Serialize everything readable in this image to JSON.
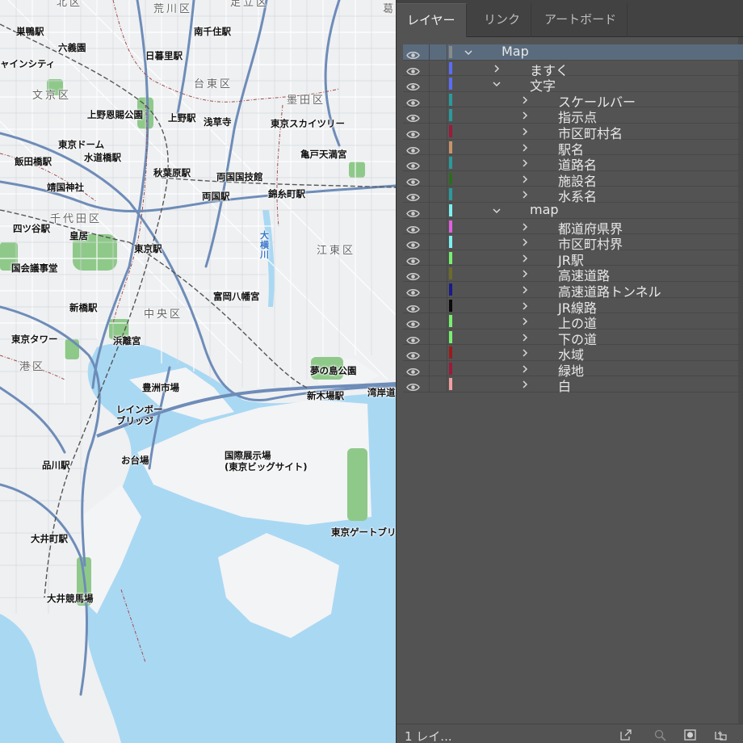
{
  "map": {
    "labels": [
      {
        "text": "北区",
        "cls": "ward"
      },
      {
        "text": "荒川区",
        "cls": "ward"
      },
      {
        "text": "足立区",
        "cls": "ward"
      },
      {
        "text": "葛",
        "cls": "ward"
      },
      {
        "text": "巣鴨駅",
        "cls": ""
      },
      {
        "text": "六義園",
        "cls": ""
      },
      {
        "text": "南千住駅",
        "cls": ""
      },
      {
        "text": "ャインシティ",
        "cls": ""
      },
      {
        "text": "日暮里駅",
        "cls": ""
      },
      {
        "text": "台東区",
        "cls": "ward"
      },
      {
        "text": "文京区",
        "cls": "ward"
      },
      {
        "text": "墨田区",
        "cls": "ward"
      },
      {
        "text": "上野恩賜公園",
        "cls": ""
      },
      {
        "text": "上野駅",
        "cls": ""
      },
      {
        "text": "浅草寺",
        "cls": ""
      },
      {
        "text": "東京スカイツリー",
        "cls": ""
      },
      {
        "text": "東京ドーム",
        "cls": ""
      },
      {
        "text": "水道橋駅",
        "cls": ""
      },
      {
        "text": "亀戸天満宮",
        "cls": ""
      },
      {
        "text": "飯田橋駅",
        "cls": ""
      },
      {
        "text": "秋葉原駅",
        "cls": ""
      },
      {
        "text": "両国国技館",
        "cls": ""
      },
      {
        "text": "靖国神社",
        "cls": ""
      },
      {
        "text": "両国駅",
        "cls": ""
      },
      {
        "text": "錦糸町駅",
        "cls": ""
      },
      {
        "text": "千代田区",
        "cls": "ward"
      },
      {
        "text": "四ツ谷駅",
        "cls": ""
      },
      {
        "text": "皇居",
        "cls": ""
      },
      {
        "text": "東京駅",
        "cls": ""
      },
      {
        "text": "江東区",
        "cls": "ward"
      },
      {
        "text": "国会議事堂",
        "cls": ""
      },
      {
        "text": "富岡八幡宮",
        "cls": ""
      },
      {
        "text": "新橋駅",
        "cls": ""
      },
      {
        "text": "中央区",
        "cls": "ward"
      },
      {
        "text": "東京タワー",
        "cls": ""
      },
      {
        "text": "浜離宮",
        "cls": ""
      },
      {
        "text": "港区",
        "cls": "ward"
      },
      {
        "text": "夢の島公園",
        "cls": ""
      },
      {
        "text": "豊洲市場",
        "cls": ""
      },
      {
        "text": "新木場駅",
        "cls": ""
      },
      {
        "text": "湾岸道",
        "cls": ""
      },
      {
        "text": "レインボー\nブリッジ",
        "cls": "tall"
      },
      {
        "text": "国際展示場\n(東京ビッグサイト)",
        "cls": "tall"
      },
      {
        "text": "お台場",
        "cls": ""
      },
      {
        "text": "品川駅",
        "cls": ""
      },
      {
        "text": "東京ゲートブリ",
        "cls": ""
      },
      {
        "text": "大井町駅",
        "cls": ""
      },
      {
        "text": "大井競馬場",
        "cls": ""
      },
      {
        "text": "大横川",
        "cls": "tall"
      }
    ]
  },
  "panel": {
    "tabs": [
      "レイヤー",
      "リンク",
      "アートボード"
    ],
    "active_tab": "レイヤー",
    "layers": [
      {
        "name": "Map",
        "color": "#8a8a8a",
        "depth": 0,
        "expanded": true,
        "selected": true
      },
      {
        "name": "ますく",
        "color": "#5b6cf5",
        "depth": 1,
        "expanded": false
      },
      {
        "name": "文字",
        "color": "#5b6cf5",
        "depth": 1,
        "expanded": true
      },
      {
        "name": "スケールバー",
        "color": "#2a9a9c",
        "depth": 2,
        "expanded": false
      },
      {
        "name": "指示点",
        "color": "#2a9a9c",
        "depth": 2,
        "expanded": false
      },
      {
        "name": "市区町村名",
        "color": "#9c1a3a",
        "depth": 2,
        "expanded": false
      },
      {
        "name": "駅名",
        "color": "#c8946a",
        "depth": 2,
        "expanded": false
      },
      {
        "name": "道路名",
        "color": "#2a9a9c",
        "depth": 2,
        "expanded": false
      },
      {
        "name": "施設名",
        "color": "#2e6b1e",
        "depth": 2,
        "expanded": false
      },
      {
        "name": "水系名",
        "color": "#2a9a9c",
        "depth": 2,
        "expanded": false
      },
      {
        "name": "map",
        "color": "#7ef0f0",
        "depth": 1,
        "expanded": true
      },
      {
        "name": "都道府県界",
        "color": "#e060e0",
        "depth": 2,
        "expanded": false
      },
      {
        "name": "市区町村界",
        "color": "#7ef0f0",
        "depth": 2,
        "expanded": false
      },
      {
        "name": "JR駅",
        "color": "#78f070",
        "depth": 2,
        "expanded": false
      },
      {
        "name": "高速道路",
        "color": "#6b6b2a",
        "depth": 2,
        "expanded": false
      },
      {
        "name": "高速道路トンネル",
        "color": "#1a1a8a",
        "depth": 2,
        "expanded": false
      },
      {
        "name": "JR線路",
        "color": "#0a0a0a",
        "depth": 2,
        "expanded": false
      },
      {
        "name": "上の道",
        "color": "#78f070",
        "depth": 2,
        "expanded": false
      },
      {
        "name": "下の道",
        "color": "#78f070",
        "depth": 2,
        "expanded": false
      },
      {
        "name": "水域",
        "color": "#9c1a1a",
        "depth": 2,
        "expanded": false
      },
      {
        "name": "緑地",
        "color": "#9c1a3a",
        "depth": 2,
        "expanded": false
      },
      {
        "name": "白",
        "color": "#f0a0a0",
        "depth": 2,
        "expanded": false
      }
    ],
    "footer": {
      "layer_count": "1 レイ...",
      "icons": [
        "export-icon",
        "locate-object-icon",
        "make-clipping-mask-icon",
        "new-sublayer-icon"
      ]
    }
  }
}
